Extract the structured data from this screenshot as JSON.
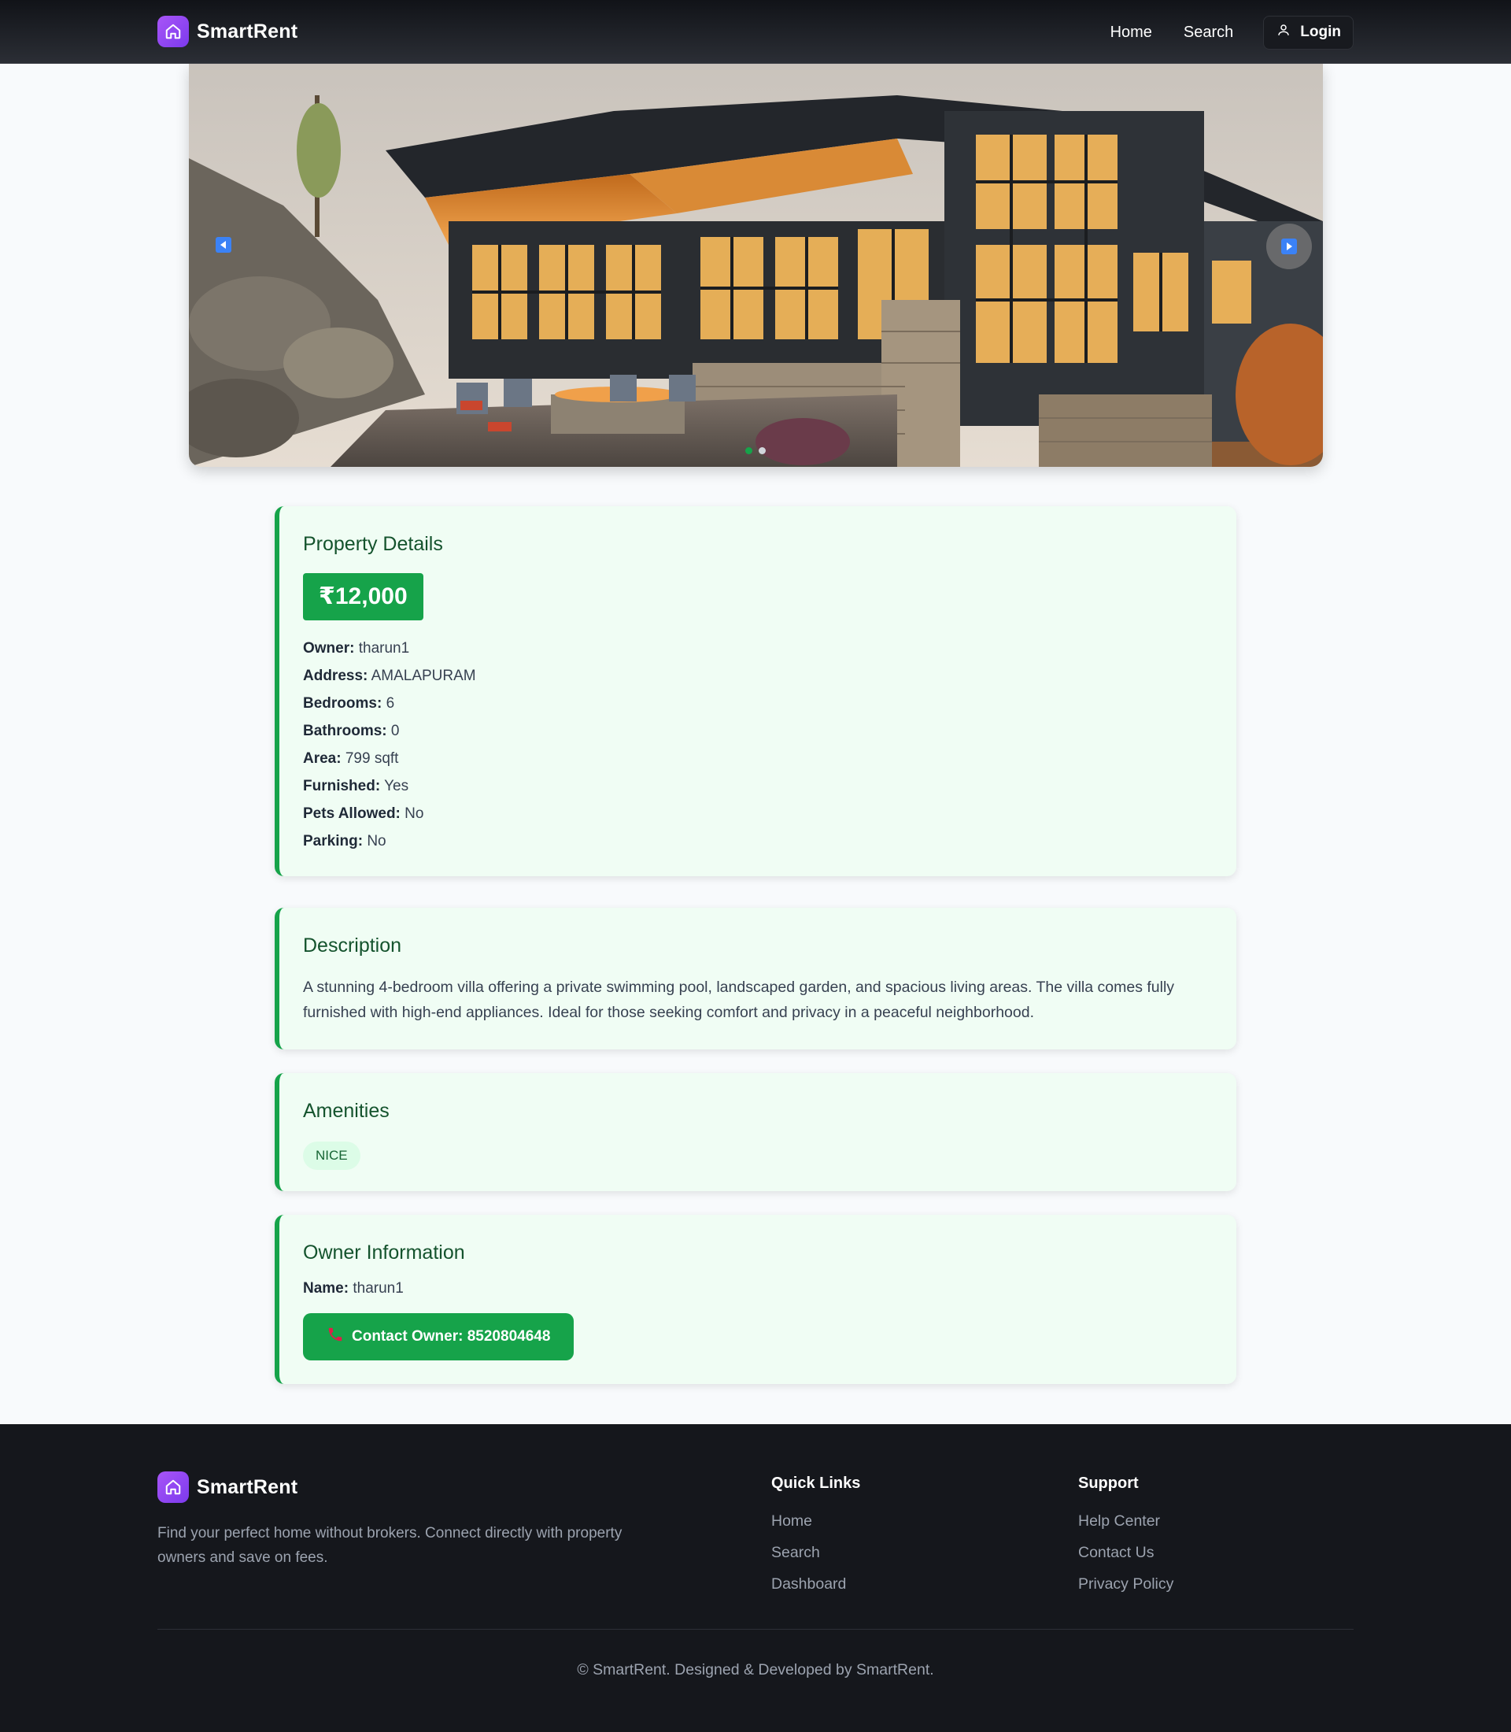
{
  "header": {
    "brand": "SmartRent",
    "nav": {
      "home": "Home",
      "search": "Search",
      "login": "Login"
    }
  },
  "carousel": {
    "slide_count": 2,
    "active_index": 0
  },
  "property_details": {
    "title": "Property Details",
    "price": "₹12,000",
    "rows": [
      {
        "label": "Owner:",
        "value": "tharun1"
      },
      {
        "label": "Address:",
        "value": "AMALAPURAM"
      },
      {
        "label": "Bedrooms:",
        "value": "6"
      },
      {
        "label": "Bathrooms:",
        "value": "0"
      },
      {
        "label": "Area:",
        "value": "799 sqft"
      },
      {
        "label": "Furnished:",
        "value": "Yes"
      },
      {
        "label": "Pets Allowed:",
        "value": "No"
      },
      {
        "label": "Parking:",
        "value": "No"
      }
    ]
  },
  "description": {
    "title": "Description",
    "text": "A stunning 4-bedroom villa offering a private swimming pool, landscaped garden, and spacious living areas. The villa comes fully furnished with high-end appliances. Ideal for those seeking comfort and privacy in a peaceful neighborhood."
  },
  "amenities": {
    "title": "Amenities",
    "tags": [
      "NICE"
    ]
  },
  "owner": {
    "title": "Owner Information",
    "name_label": "Name:",
    "name_value": "tharun1",
    "contact_label": "Contact Owner: 8520804648"
  },
  "footer": {
    "brand": "SmartRent",
    "about": "Find your perfect home without brokers. Connect directly with property owners and save on fees.",
    "quick_links": {
      "title": "Quick Links",
      "items": [
        "Home",
        "Search",
        "Dashboard"
      ]
    },
    "support": {
      "title": "Support",
      "items": [
        "Help Center",
        "Contact Us",
        "Privacy Policy"
      ]
    },
    "copyright": "© SmartRent. Designed & Developed by SmartRent."
  },
  "colors": {
    "brand_purple": "#a855f7",
    "accent_green": "#16a34a",
    "card_bg": "#f0fdf4",
    "dark": "#15171c"
  },
  "icons": {
    "logo": "house-icon",
    "login": "user-icon",
    "prev": "triangle-left-icon",
    "next": "triangle-right-icon",
    "contact": "phone-icon"
  }
}
